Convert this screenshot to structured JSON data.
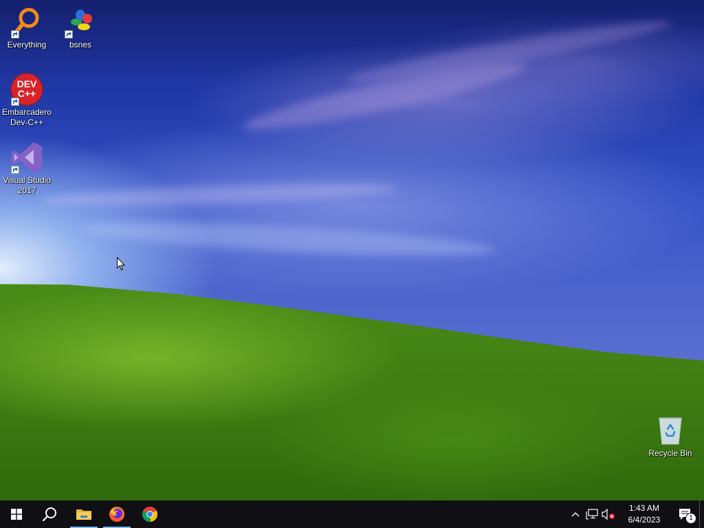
{
  "desktop": {
    "icons": [
      {
        "label": "Everything",
        "icon": "everything-icon"
      },
      {
        "label": "bsnes",
        "icon": "bsnes-icon"
      },
      {
        "label": "Embarcadero Dev-C++",
        "icon": "devcpp-icon",
        "badge_text": "DEV C++"
      },
      {
        "label": "Visual Studio 2017",
        "icon": "visual-studio-icon"
      },
      {
        "label": "Recycle Bin",
        "icon": "recycle-bin-icon"
      }
    ]
  },
  "taskbar": {
    "buttons": [
      {
        "name": "start-button",
        "icon": "windows-logo-icon"
      },
      {
        "name": "search-button",
        "icon": "search-icon"
      },
      {
        "name": "file-explorer-button",
        "icon": "folder-icon",
        "active": true
      },
      {
        "name": "firefox-button",
        "icon": "firefox-icon",
        "active": true
      },
      {
        "name": "chrome-button",
        "icon": "chrome-icon"
      }
    ],
    "tray": {
      "time": "1:43 AM",
      "date": "6/4/2023",
      "notification_count": "1"
    }
  },
  "colors": {
    "taskbar_bg": "#101014",
    "active_indicator": "#76b9ed"
  }
}
